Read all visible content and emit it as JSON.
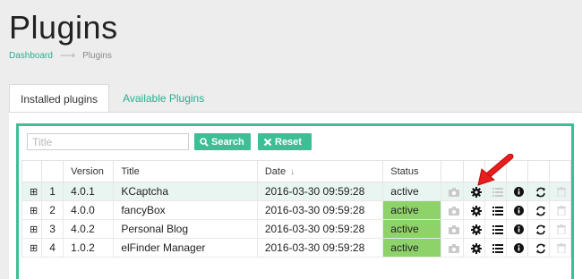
{
  "page": {
    "title": "Plugins"
  },
  "breadcrumb": {
    "items": [
      "Dashboard",
      "Plugins"
    ],
    "separator": "⟶"
  },
  "tabs": {
    "installed": "Installed plugins",
    "available": "Available Plugins"
  },
  "search": {
    "placeholder": "Title",
    "value": "",
    "search_label": "Search",
    "reset_label": "Reset"
  },
  "table": {
    "headers": {
      "version": "Version",
      "title": "Title",
      "date": "Date",
      "date_sort": "↓",
      "status": "Status"
    },
    "rows": [
      {
        "num": "1",
        "version": "4.0.1",
        "title": "KCaptcha",
        "date": "2016-03-30 09:59:28",
        "status": "active"
      },
      {
        "num": "2",
        "version": "4.0.0",
        "title": "fancyBox",
        "date": "2016-03-30 09:59:28",
        "status": "active"
      },
      {
        "num": "3",
        "version": "4.0.2",
        "title": "Personal Blog",
        "date": "2016-03-30 09:59:28",
        "status": "active"
      },
      {
        "num": "4",
        "version": "1.0.2",
        "title": "elFinder Manager",
        "date": "2016-03-30 09:59:28",
        "status": "active"
      }
    ]
  },
  "icons": [
    "expand-icon",
    "camera-icon",
    "gear-icon",
    "list-icon",
    "info-icon",
    "refresh-icon",
    "trash-icon"
  ],
  "colors": {
    "accent": "#3dbf96",
    "active_status": "#8ed36a",
    "row_highlight": "#e8f5f0",
    "arrow": "#e81d1d"
  }
}
